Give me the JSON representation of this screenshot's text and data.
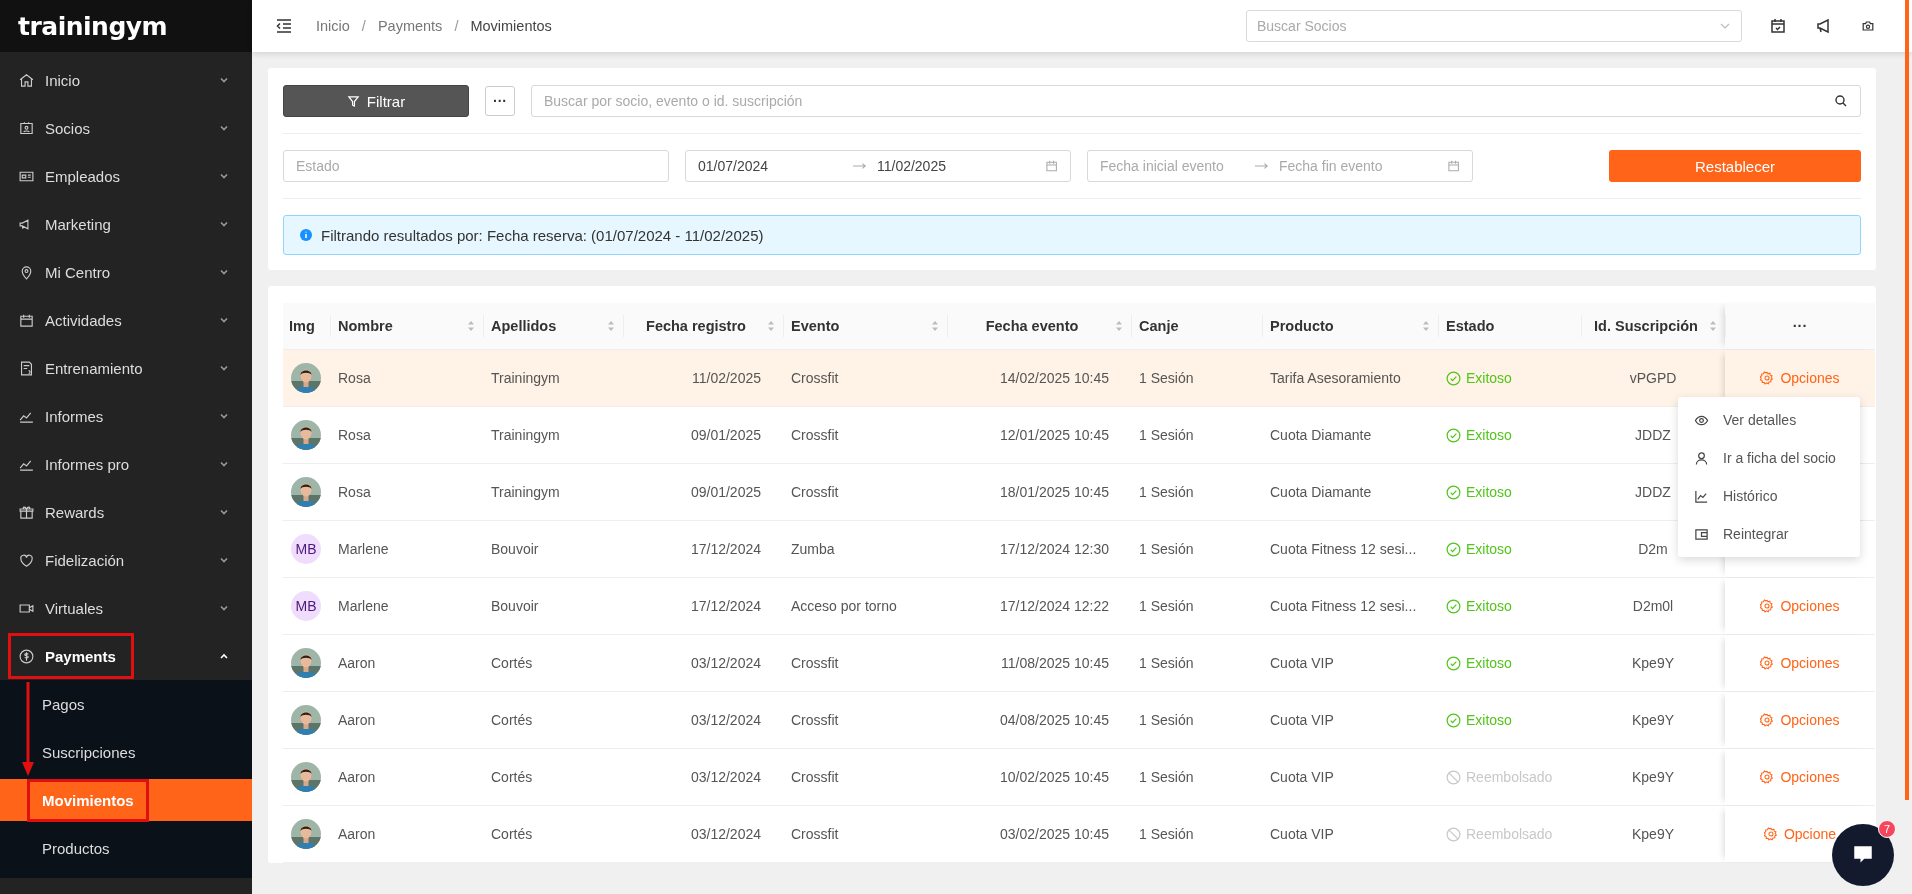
{
  "brand": {
    "logo": "trainingym"
  },
  "sidebar": {
    "items": [
      {
        "label": "Inicio",
        "expanded": false,
        "annotated": false
      },
      {
        "label": "Socios",
        "expanded": false,
        "annotated": false
      },
      {
        "label": "Empleados",
        "expanded": false,
        "annotated": false
      },
      {
        "label": "Marketing",
        "expanded": false,
        "annotated": false
      },
      {
        "label": "Mi Centro",
        "expanded": false,
        "annotated": false
      },
      {
        "label": "Actividades",
        "expanded": false,
        "annotated": false
      },
      {
        "label": "Entrenamiento",
        "expanded": false,
        "annotated": false
      },
      {
        "label": "Informes",
        "expanded": false,
        "annotated": false
      },
      {
        "label": "Informes pro",
        "expanded": false,
        "annotated": false
      },
      {
        "label": "Rewards",
        "expanded": false,
        "annotated": false
      },
      {
        "label": "Fidelización",
        "expanded": false,
        "annotated": false
      },
      {
        "label": "Virtuales",
        "expanded": false,
        "annotated": false
      },
      {
        "label": "Payments",
        "expanded": true,
        "annotated": true,
        "children": [
          {
            "label": "Pagos",
            "selected": false,
            "annotated": false
          },
          {
            "label": "Suscripciones",
            "selected": false,
            "annotated": false
          },
          {
            "label": "Movimientos",
            "selected": true,
            "annotated": true
          },
          {
            "label": "Productos",
            "selected": false,
            "annotated": false
          }
        ]
      }
    ]
  },
  "breadcrumb": {
    "separator": "/",
    "items": [
      "Inicio",
      "Payments",
      "Movimientos"
    ]
  },
  "member_search": {
    "placeholder": "Buscar Socios"
  },
  "filters": {
    "filter_button": "Filtrar",
    "more_button": "···",
    "search": {
      "placeholder": "Buscar por socio, evento o id. suscripción"
    },
    "status": {
      "placeholder": "Estado"
    },
    "booking_range": {
      "from": "01/07/2024",
      "to": "11/02/2025"
    },
    "event_range": {
      "from_placeholder": "Fecha inicial evento",
      "to_placeholder": "Fecha fin evento"
    },
    "reset_button": "Restablecer",
    "info": "Filtrando resultados por: Fecha reserva: (01/07/2024 - 11/02/2025)"
  },
  "table": {
    "columns": [
      {
        "label": "Img",
        "sortable": false
      },
      {
        "label": "Nombre",
        "sortable": true
      },
      {
        "label": "Apellidos",
        "sortable": true
      },
      {
        "label": "Fecha registro",
        "sortable": true
      },
      {
        "label": "Evento",
        "sortable": true
      },
      {
        "label": "Fecha evento",
        "sortable": true
      },
      {
        "label": "Canje",
        "sortable": false
      },
      {
        "label": "Producto",
        "sortable": true
      },
      {
        "label": "Estado",
        "sortable": false
      },
      {
        "label": "Id. Suscripción",
        "sortable": true
      },
      {
        "label": "···",
        "sortable": false
      }
    ],
    "rows": [
      {
        "selected": true,
        "name": "Rosa",
        "surname": "Trainingym",
        "registered": "11/02/2025",
        "event": "Crossfit",
        "event_date": "14/02/2025 10:45",
        "redeem": "1 Sesión",
        "product": "Tarifa Asesoramiento",
        "status": {
          "kind": "success",
          "label": "Exitoso"
        },
        "subscription": "vPGPD",
        "action": "Opciones"
      },
      {
        "selected": false,
        "name": "Rosa",
        "surname": "Trainingym",
        "registered": "09/01/2025",
        "event": "Crossfit",
        "event_date": "12/01/2025 10:45",
        "redeem": "1 Sesión",
        "product": "Cuota Diamante",
        "status": {
          "kind": "success",
          "label": "Exitoso"
        },
        "subscription": "JDDZ"
      },
      {
        "selected": false,
        "name": "Rosa",
        "surname": "Trainingym",
        "registered": "09/01/2025",
        "event": "Crossfit",
        "event_date": "18/01/2025 10:45",
        "redeem": "1 Sesión",
        "product": "Cuota Diamante",
        "status": {
          "kind": "success",
          "label": "Exitoso"
        },
        "subscription": "JDDZ"
      },
      {
        "selected": false,
        "avatar": {
          "kind": "initials",
          "text": "MB"
        },
        "name": "Marlene",
        "surname": "Bouvoir",
        "registered": "17/12/2024",
        "event": "Zumba",
        "event_date": "17/12/2024 12:30",
        "redeem": "1 Sesión",
        "product": "Cuota Fitness 12 sesi...",
        "status": {
          "kind": "success",
          "label": "Exitoso"
        },
        "subscription": "D2m"
      },
      {
        "selected": false,
        "avatar": {
          "kind": "initials",
          "text": "MB"
        },
        "name": "Marlene",
        "surname": "Bouvoir",
        "registered": "17/12/2024",
        "event": "Acceso por torno",
        "event_date": "17/12/2024 12:22",
        "redeem": "1 Sesión",
        "product": "Cuota Fitness 12 sesi...",
        "status": {
          "kind": "success",
          "label": "Exitoso"
        },
        "subscription": "D2m0l",
        "action": "Opciones"
      },
      {
        "selected": false,
        "name": "Aaron",
        "surname": "Cortés",
        "registered": "03/12/2024",
        "event": "Crossfit",
        "event_date": "11/08/2025 10:45",
        "redeem": "1 Sesión",
        "product": "Cuota VIP",
        "status": {
          "kind": "success",
          "label": "Exitoso"
        },
        "subscription": "Kpe9Y",
        "action": "Opciones"
      },
      {
        "selected": false,
        "name": "Aaron",
        "surname": "Cortés",
        "registered": "03/12/2024",
        "event": "Crossfit",
        "event_date": "04/08/2025 10:45",
        "redeem": "1 Sesión",
        "product": "Cuota VIP",
        "status": {
          "kind": "success",
          "label": "Exitoso"
        },
        "subscription": "Kpe9Y",
        "action": "Opciones"
      },
      {
        "selected": false,
        "name": "Aaron",
        "surname": "Cortés",
        "registered": "03/12/2024",
        "event": "Crossfit",
        "event_date": "10/02/2025 10:45",
        "redeem": "1 Sesión",
        "product": "Cuota VIP",
        "status": {
          "kind": "refunded",
          "label": "Reembolsado"
        },
        "subscription": "Kpe9Y",
        "action": "Opciones"
      },
      {
        "selected": false,
        "name": "Aaron",
        "surname": "Cortés",
        "registered": "03/12/2024",
        "event": "Crossfit",
        "event_date": "03/02/2025 10:45",
        "redeem": "1 Sesión",
        "product": "Cuota VIP",
        "status": {
          "kind": "refunded",
          "label": "Reembolsado"
        },
        "subscription": "Kpe9Y",
        "action": "Opcione"
      }
    ]
  },
  "row_menu": {
    "items": [
      {
        "kind": "eye",
        "label": "Ver detalles"
      },
      {
        "kind": "user",
        "label": "Ir a ficha del socio"
      },
      {
        "kind": "chart",
        "label": "Histórico"
      },
      {
        "kind": "refund",
        "label": "Reintegrar"
      }
    ]
  },
  "chat": {
    "badge": "7"
  }
}
